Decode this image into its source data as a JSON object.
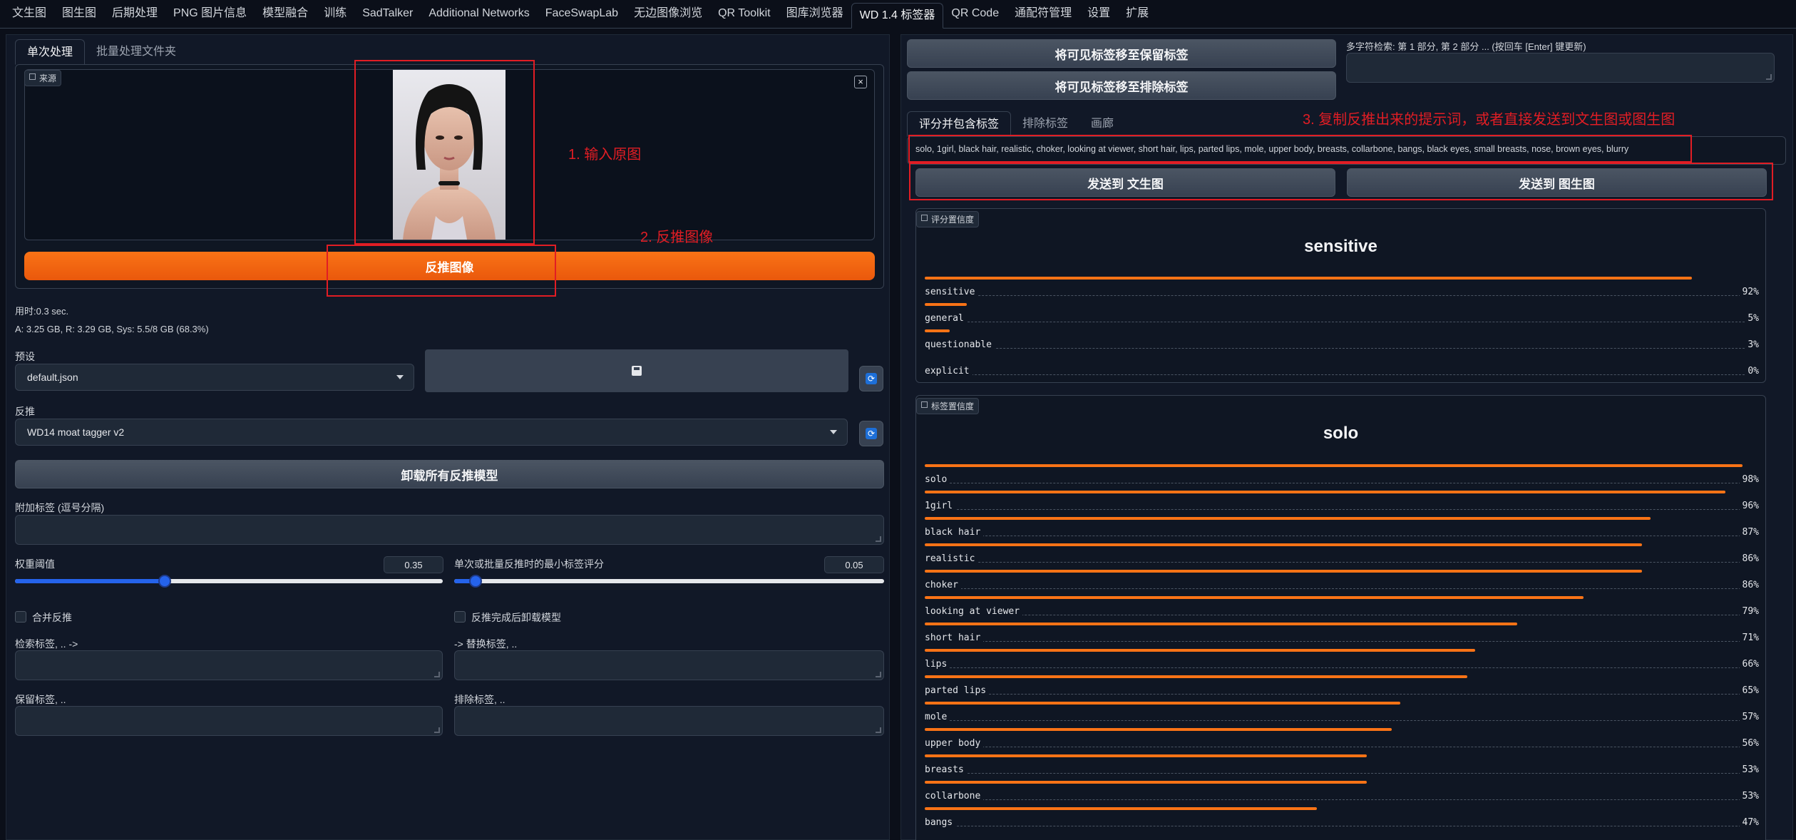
{
  "nav": {
    "tabs": [
      "文生图",
      "图生图",
      "后期处理",
      "PNG 图片信息",
      "模型融合",
      "训练",
      "SadTalker",
      "Additional Networks",
      "FaceSwapLab",
      "无边图像浏览",
      "QR Toolkit",
      "图库浏览器",
      "WD 1.4 标签器",
      "QR Code",
      "通配符管理",
      "设置",
      "扩展"
    ],
    "active_index": 12
  },
  "left": {
    "tabs": [
      "单次处理",
      "批量处理文件夹"
    ],
    "source_label": "来源",
    "interrogate_button": "反推图像",
    "time_text": "用时:0.3 sec.",
    "mem_text": "A: 3.25 GB, R: 3.29 GB, Sys: 5.5/8 GB (68.3%)",
    "preset_label": "预设",
    "preset_value": "default.json",
    "interrogator_label": "反推",
    "interrogator_value": "WD14 moat tagger v2",
    "unload_button": "卸载所有反推模型",
    "additional_tags_label": "附加标签 (逗号分隔)",
    "threshold_label": "权重阈值",
    "threshold_value": "0.35",
    "threshold_fraction": 0.35,
    "min_score_label": "单次或批量反推时的最小标签评分",
    "min_score_value": "0.05",
    "min_score_fraction": 0.05,
    "combine_label": "合并反推",
    "unload_after_label": "反推完成后卸载模型",
    "search_label": "检索标签, .. ->",
    "replace_label": "-> 替换标签, ..",
    "keep_label": "保留标签, ..",
    "exclude_label": "排除标签, .."
  },
  "right": {
    "move_keep_button": "将可见标签移至保留标签",
    "move_exclude_button": "将可见标签移至排除标签",
    "search_label": "多字符检索: 第 1 部分, 第 2 部分 ... (按回车 [Enter] 键更新)",
    "tabs": [
      "评分并包含标签",
      "排除标签",
      "画廊"
    ],
    "tags_output": "solo, 1girl, black hair, realistic, choker, looking at viewer, short hair, lips, parted lips, mole, upper body, breasts, collarbone, bangs, black eyes, small breasts, nose, brown eyes, blurry",
    "send_txt2img": "发送到 文生图",
    "send_img2img": "发送到 图生图",
    "rating_chip": "评分置信度",
    "rating_title": "sensitive",
    "ratings": [
      {
        "name": "sensitive",
        "pct": "92%",
        "value": 0.92
      },
      {
        "name": "general",
        "pct": "5%",
        "value": 0.05
      },
      {
        "name": "questionable",
        "pct": "3%",
        "value": 0.03
      },
      {
        "name": "explicit",
        "pct": "0%",
        "value": 0.0
      }
    ],
    "tag_chip": "标签置信度",
    "tag_title": "solo",
    "tags": [
      {
        "name": "solo",
        "pct": "98%",
        "value": 0.98
      },
      {
        "name": "1girl",
        "pct": "96%",
        "value": 0.96
      },
      {
        "name": "black hair",
        "pct": "87%",
        "value": 0.87
      },
      {
        "name": "realistic",
        "pct": "86%",
        "value": 0.86
      },
      {
        "name": "choker",
        "pct": "86%",
        "value": 0.86
      },
      {
        "name": "looking at viewer",
        "pct": "79%",
        "value": 0.79
      },
      {
        "name": "short hair",
        "pct": "71%",
        "value": 0.71
      },
      {
        "name": "lips",
        "pct": "66%",
        "value": 0.66
      },
      {
        "name": "parted lips",
        "pct": "65%",
        "value": 0.65
      },
      {
        "name": "mole",
        "pct": "57%",
        "value": 0.57
      },
      {
        "name": "upper body",
        "pct": "56%",
        "value": 0.56
      },
      {
        "name": "breasts",
        "pct": "53%",
        "value": 0.53
      },
      {
        "name": "collarbone",
        "pct": "53%",
        "value": 0.53
      },
      {
        "name": "bangs",
        "pct": "47%",
        "value": 0.47
      }
    ]
  },
  "annotations": {
    "step1": "1. 输入原图",
    "step2": "2. 反推图像",
    "step3": "3. 复制反推出来的提示词，或者直接发送到文生图或图生图"
  },
  "colors": {
    "accent": "#f97316",
    "annotation": "#e11d24",
    "slider": "#2563eb"
  }
}
